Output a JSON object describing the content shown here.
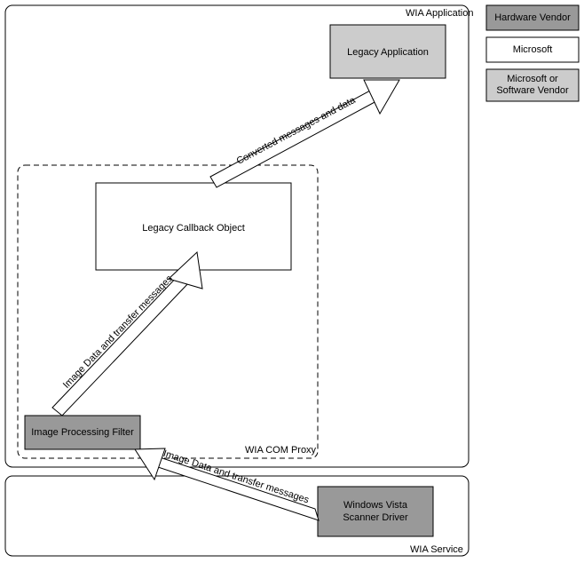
{
  "frame": {
    "outer_title": "WIA Application",
    "service_title": "WIA Service",
    "proxy_title": "WIA COM Proxy"
  },
  "legend": {
    "hardware_vendor": "Hardware Vendor",
    "microsoft": "Microsoft",
    "ms_or_sw_vendor_line1": "Microsoft or",
    "ms_or_sw_vendor_line2": "Software Vendor"
  },
  "boxes": {
    "legacy_app": "Legacy Application",
    "legacy_callback": "Legacy Callback Object",
    "img_filter": "Image Processing Filter",
    "scanner_driver_line1": "Windows Vista",
    "scanner_driver_line2": "Scanner Driver"
  },
  "arrows": {
    "converted": "Converted messages and data",
    "img_data_1": "Image Data and transfer messages",
    "img_data_2": "Image Data and transfer messages"
  },
  "colors": {
    "hardware_vendor_fill": "#999999",
    "microsoft_fill": "#ffffff",
    "ms_or_sw_fill": "#cccccc",
    "stroke": "#000000"
  }
}
